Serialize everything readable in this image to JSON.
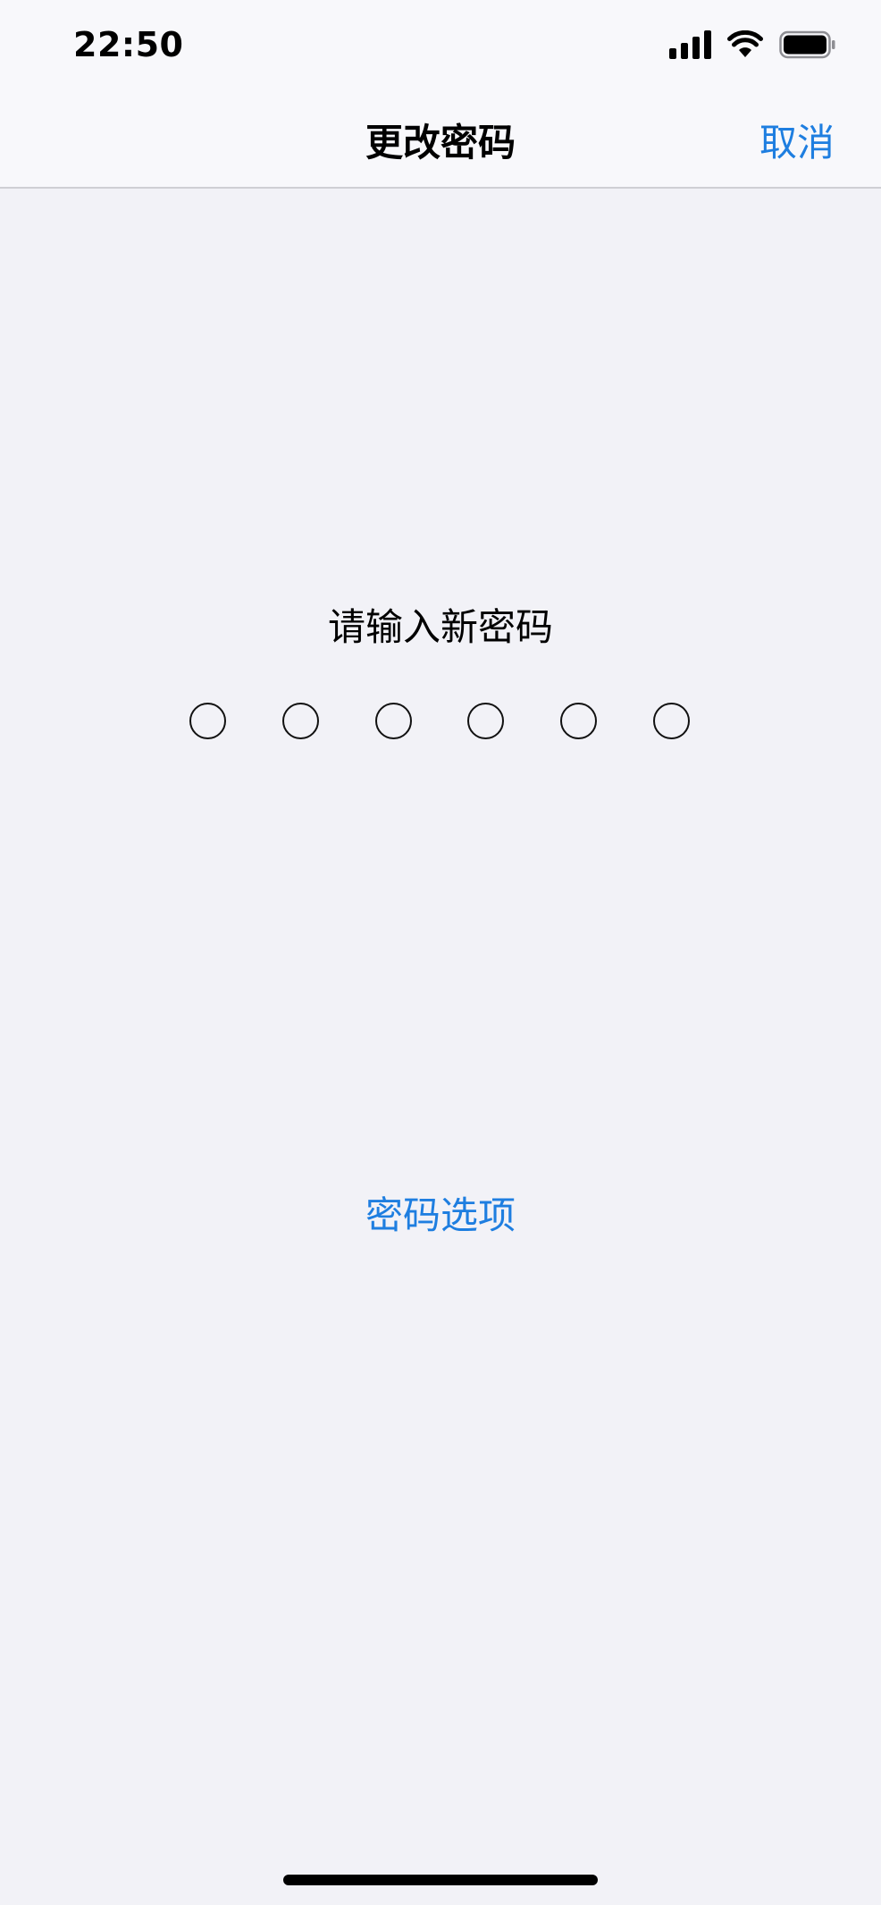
{
  "status_bar": {
    "time": "22:50",
    "icons": [
      "signal-icon",
      "wifi-icon",
      "battery-icon"
    ]
  },
  "nav": {
    "title": "更改密码",
    "cancel_label": "取消"
  },
  "main": {
    "prompt": "请输入新密码",
    "passcode_length": 6,
    "passcode_filled": 0,
    "options_label": "密码选项"
  },
  "colors": {
    "accent": "#1e7ee0",
    "background": "#f2f2f7",
    "nav_background": "#f8f8fb",
    "separator": "#cfcfd4"
  }
}
